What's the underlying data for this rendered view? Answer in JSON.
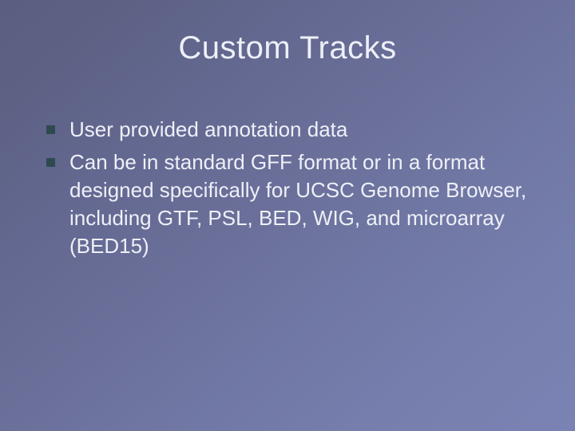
{
  "title": "Custom Tracks",
  "bullets": [
    "User provided annotation data",
    "Can be in standard GFF format or in a format designed specifically for UCSC Genome Browser, including GTF, PSL, BED, WIG, and microarray (BED15)"
  ]
}
